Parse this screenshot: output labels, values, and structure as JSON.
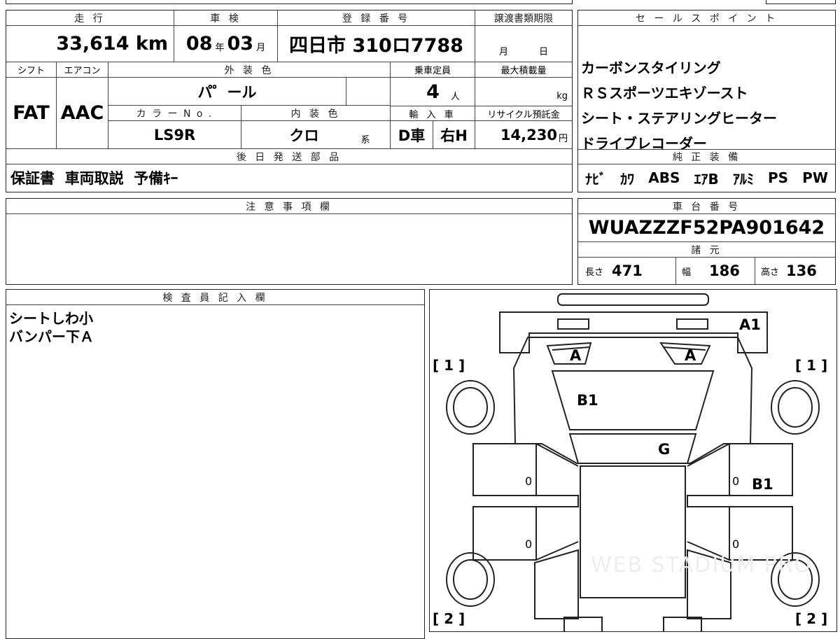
{
  "top_section": {
    "headers": {
      "mileage": "走 行",
      "inspection": "車 検",
      "registration": "登 録 番 号",
      "transfer_deadline": "譲渡書類期限",
      "shift": "シフト",
      "aircon": "エアコン",
      "exterior_color": "外 装 色",
      "capacity": "乗車定員",
      "max_load": "最大積載量",
      "color_no": "カ ラ ー N o .",
      "interior_color": "内 装 色",
      "import": "輸 入 車",
      "recycle_fee": "リサイクル預託金",
      "followup_parts": "後 日 発 送 部 品"
    },
    "mileage": "33,614 km",
    "inspection_year": "08",
    "inspection_year_unit": "年",
    "inspection_month": "03",
    "inspection_month_unit": "月",
    "registration": "四日市 310ロ7788",
    "deadline_month_unit": "月",
    "deadline_day_unit": "日",
    "shift": "FAT",
    "aircon": "AAC",
    "exterior_color": "パ゜ール",
    "capacity": "4",
    "capacity_unit": "人",
    "max_load_unit": "kg",
    "color_no": "LS9R",
    "interior_color": "クロ",
    "interior_color_unit": "系",
    "import_type": "D車",
    "steering": "右H",
    "recycle_fee": "14,230",
    "recycle_fee_unit": "円",
    "followup_parts": "保証書  車両取説  予備ｷｰ"
  },
  "sales_points": {
    "header": "セ ー ル ス ポ イ ン ト",
    "items": [
      "カーボンスタイリング",
      "ＲＳスポーツエキゾースト",
      "シート・ステアリングヒーター",
      "ドライブレコーダー"
    ]
  },
  "genuine_equipment": {
    "header": "純 正 装 備",
    "items": [
      "ﾅﾋﾞ",
      "ｶﾜ",
      "ABS",
      "ｴｱB",
      "ｱﾙﾐ",
      "PS",
      "PW"
    ]
  },
  "notes": {
    "header": "注 意 事 項 欄",
    "content": ""
  },
  "chassis": {
    "header": "車 台 番 号",
    "number": "WUAZZZF52PA901642",
    "specs_header": "諸 元",
    "length_label": "長さ",
    "length": "471",
    "width_label": "幅",
    "width": "186",
    "height_label": "高さ",
    "height": "136"
  },
  "inspector": {
    "header": "検 査 員 記 入 欄",
    "lines": [
      "シートしわ小",
      "バンパー下Ａ"
    ]
  },
  "diagram": {
    "marks": {
      "front_bumper": "A1",
      "headlight_left": "A",
      "headlight_right": "A",
      "hood": "B1",
      "windshield": "G",
      "right_front_door": "B1",
      "zero_1": "0",
      "zero_2": "0",
      "zero_3": "0",
      "zero_4": "0"
    },
    "brackets": {
      "front_left": "[ 1 ]",
      "front_right": "[ 1 ]",
      "rear_left": "[ 2 ]",
      "rear_right": "[ 2 ]"
    },
    "watermark": "WEB STADIUM PRO"
  }
}
